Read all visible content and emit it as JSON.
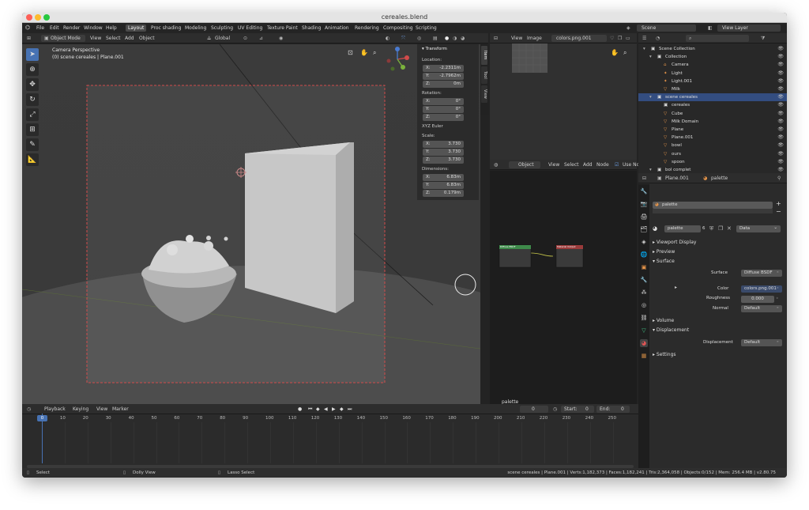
{
  "window": {
    "title": "cereales.blend"
  },
  "menu": [
    "File",
    "Edit",
    "Render",
    "Window",
    "Help"
  ],
  "workspaces": [
    "Layout",
    "Proc shading",
    "Modeling",
    "Sculpting",
    "UV Editing",
    "Texture Paint",
    "Shading",
    "Animation",
    "Rendering",
    "Compositing",
    "Scripting"
  ],
  "top_right": {
    "scene": "Scene",
    "view_layer": "View Layer"
  },
  "viewport": {
    "mode": "Object Mode",
    "menu": [
      "View",
      "Select",
      "Add",
      "Object"
    ],
    "transform_orientation": "Global",
    "overlay_line1": "Camera Perspective",
    "overlay_line2": "(0) scene cereales | Plane.001"
  },
  "npanel": {
    "tabs": [
      "Item",
      "Tool",
      "View"
    ],
    "header": "Transform",
    "location_label": "Location:",
    "location": [
      {
        "axis": "X:",
        "value": "-2.2311m"
      },
      {
        "axis": "Y:",
        "value": "-2.7962m"
      },
      {
        "axis": "Z:",
        "value": "0m"
      }
    ],
    "rotation_label": "Rotation:",
    "rotation": [
      {
        "axis": "X:",
        "value": "0°"
      },
      {
        "axis": "Y:",
        "value": "0°"
      },
      {
        "axis": "Z:",
        "value": "0°"
      }
    ],
    "rotation_mode": "XYZ Euler",
    "scale_label": "Scale:",
    "scale": [
      {
        "axis": "X:",
        "value": "3.730"
      },
      {
        "axis": "Y:",
        "value": "3.730"
      },
      {
        "axis": "Z:",
        "value": "3.730"
      }
    ],
    "dimensions_label": "Dimensions:",
    "dimensions": [
      {
        "axis": "X:",
        "value": "6.83m"
      },
      {
        "axis": "Y:",
        "value": "6.83m"
      },
      {
        "axis": "Z:",
        "value": "0.179m"
      }
    ]
  },
  "image_editor": {
    "menu": [
      "View",
      "Image"
    ],
    "image": "colors.png.001"
  },
  "node_editor": {
    "object": "Object",
    "menu": [
      "View",
      "Select",
      "Add",
      "Node"
    ],
    "use_nodes": "Use No",
    "label": "palette",
    "node1": "Diffuse BSDF",
    "node2": "Material Output"
  },
  "outliner": {
    "items": [
      {
        "label": "Scene Collection",
        "indent": 0,
        "icon": "collection-icon"
      },
      {
        "label": "Collection",
        "indent": 1,
        "icon": "collection-icon"
      },
      {
        "label": "Camera",
        "indent": 2,
        "icon": "camera-icon"
      },
      {
        "label": "Light",
        "indent": 2,
        "icon": "light-icon"
      },
      {
        "label": "Light.001",
        "indent": 2,
        "icon": "light-icon"
      },
      {
        "label": "Milk",
        "indent": 2,
        "icon": "mesh-icon"
      },
      {
        "label": "scene cereales",
        "indent": 1,
        "icon": "collection-icon",
        "selected": true
      },
      {
        "label": "cereales",
        "indent": 2,
        "icon": "collection-icon"
      },
      {
        "label": "Cube",
        "indent": 2,
        "icon": "mesh-icon"
      },
      {
        "label": "Milk Domain",
        "indent": 2,
        "icon": "mesh-icon"
      },
      {
        "label": "Plane",
        "indent": 2,
        "icon": "mesh-icon"
      },
      {
        "label": "Plane.001",
        "indent": 2,
        "icon": "mesh-icon"
      },
      {
        "label": "bowl",
        "indent": 2,
        "icon": "mesh-icon"
      },
      {
        "label": "ours",
        "indent": 2,
        "icon": "mesh-icon"
      },
      {
        "label": "spoon",
        "indent": 2,
        "icon": "mesh-icon"
      },
      {
        "label": "bol complet",
        "indent": 1,
        "icon": "collection-icon"
      }
    ]
  },
  "properties": {
    "object": "Plane.001",
    "material": "palette",
    "slot": "palette",
    "material_field": "palette",
    "users": "6",
    "link": "Data",
    "sections": [
      "Viewport Display",
      "Preview",
      "Surface",
      "Volume",
      "Displacement",
      "Settings"
    ],
    "surface_label": "Surface",
    "surface_value": "Diffuse BSDF",
    "color_label": "Color",
    "color_value": "colors.png.001",
    "roughness_label": "Roughness",
    "roughness_value": "0.000",
    "normal_label": "Normal",
    "normal_value": "Default",
    "displacement_label": "Displacement",
    "displacement_value": "Default"
  },
  "timeline": {
    "menu": [
      "Playback",
      "Keying",
      "View",
      "Marker"
    ],
    "current_frame": "0",
    "start_label": "Start:",
    "start": "0",
    "end_label": "End:",
    "end": "0",
    "ticks": [
      "0",
      "10",
      "20",
      "30",
      "40",
      "50",
      "60",
      "70",
      "80",
      "90",
      "100",
      "110",
      "120",
      "130",
      "140",
      "150",
      "160",
      "170",
      "180",
      "190",
      "200",
      "210",
      "220",
      "230",
      "240",
      "250"
    ]
  },
  "statusbar": {
    "select": "Select",
    "dolly": "Dolly View",
    "lasso": "Lasso Select",
    "stats": "scene cereales | Plane.001 | Verts:1,182,373 | Faces:1,182,241 | Tris:2,364,058 | Objects:0/152 | Mem: 256.4 MB | v2.80.75"
  },
  "colors": {
    "accent": "#4772b3",
    "selection": "#334d80",
    "outline_red": "#d24b4b",
    "orange_icon": "#e8964a",
    "green_icon": "#44c98a"
  }
}
